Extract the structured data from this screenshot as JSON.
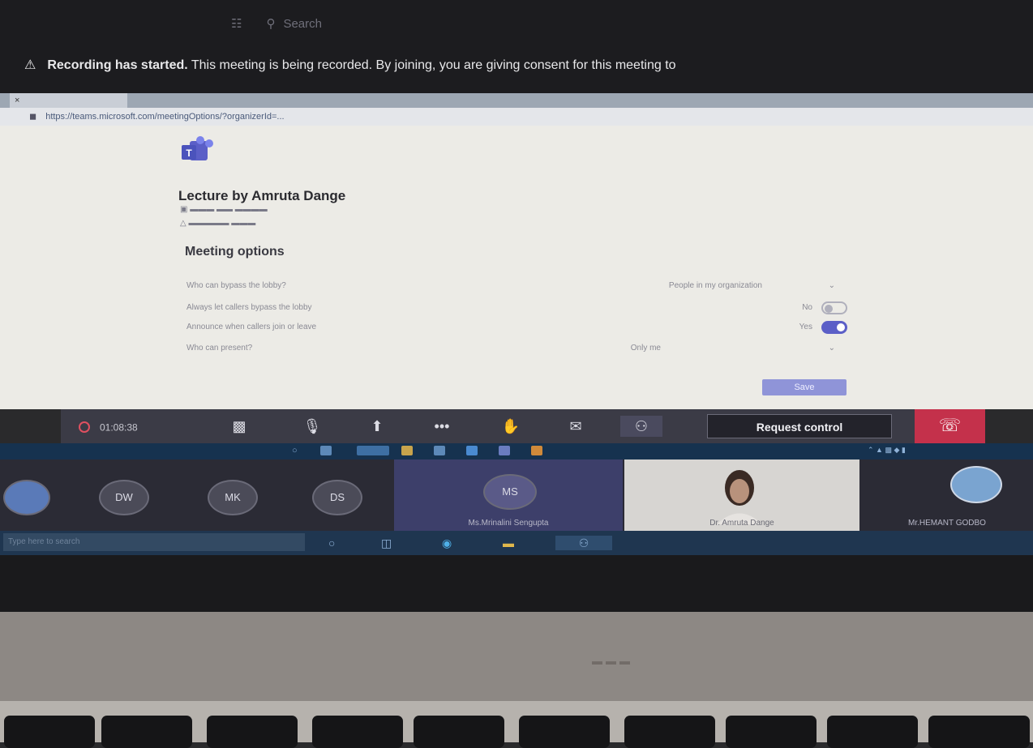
{
  "taskbar_top": {
    "search_placeholder": "Search"
  },
  "recording_banner": {
    "title": "Recording has started.",
    "message": "This meeting is being recorded. By joining, you are giving consent for this meeting to"
  },
  "browser": {
    "url": "https://teams.microsoft.com/meetingOptions/?organizerId=..."
  },
  "meeting_page": {
    "title": "Lecture by Amruta Dange",
    "options_title": "Meeting options",
    "options": [
      {
        "label": "Who can bypass the lobby?",
        "value": "People in my organization"
      },
      {
        "label": "Always let callers bypass the lobby",
        "state": "No"
      },
      {
        "label": "Announce when callers join or leave",
        "state": "Yes"
      },
      {
        "label": "Who can present?",
        "value": "Only me"
      }
    ],
    "save_label": "Save"
  },
  "call_controls": {
    "timer": "01:08:38",
    "request_control_label": "Request control"
  },
  "participants": [
    {
      "initials": "DW"
    },
    {
      "initials": "MK"
    },
    {
      "initials": "DS"
    },
    {
      "initials": "MS",
      "name": "Ms.Mrinalini Sengupta"
    },
    {
      "name": "Dr. Amruta Dange"
    },
    {
      "name": "Mr.HEMANT GODBO"
    }
  ],
  "taskbar_bottom": {
    "search_placeholder": "Type here to search"
  },
  "colors": {
    "accent": "#5b5fc7",
    "hangup": "#c4314b",
    "control_bar": "#3b3b46"
  }
}
